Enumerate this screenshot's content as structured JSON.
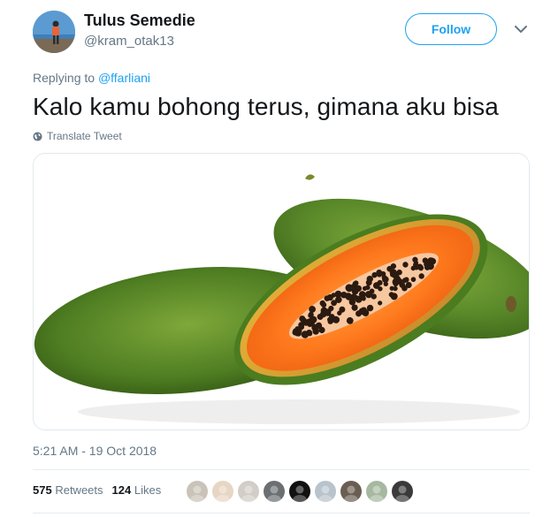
{
  "author": {
    "name": "Tulus Semedie",
    "handle": "@kram_otak13",
    "avatar_icon": "avatar-person-beach"
  },
  "follow_label": "Follow",
  "menu_icon": "chevron-down-icon",
  "reply": {
    "prefix": "Replying to",
    "to": "@ffarliani"
  },
  "tweet_text": "Kalo kamu bohong terus, gimana aku bisa",
  "translate_label": "Translate Tweet",
  "media": {
    "subject": "papaya-image"
  },
  "timestamp": "5:21 AM - 19 Oct 2018",
  "stats": {
    "retweets_count": "575",
    "retweets_label": "Retweets",
    "likes_count": "124",
    "likes_label": "Likes"
  },
  "likers": [
    {
      "color": "#c9c3b8"
    },
    {
      "color": "#e7d6c4"
    },
    {
      "color": "#d2cdc7"
    },
    {
      "color": "#6b6f72"
    },
    {
      "color": "#111111"
    },
    {
      "color": "#b8c3cc"
    },
    {
      "color": "#6a5e52"
    },
    {
      "color": "#a7b8a0"
    },
    {
      "color": "#3a3a3a"
    }
  ],
  "colors": {
    "accent": "#1da1f2",
    "secondary_text": "#657786",
    "primary_text": "#14171a"
  }
}
